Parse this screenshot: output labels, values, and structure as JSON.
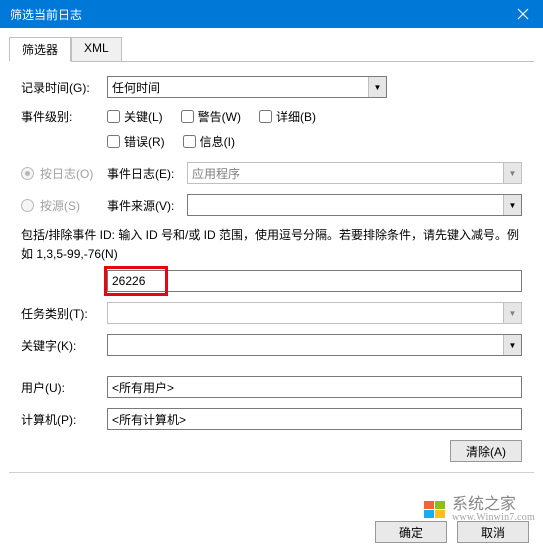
{
  "window": {
    "title": "筛选当前日志"
  },
  "tabs": {
    "filter": "筛选器",
    "xml": "XML"
  },
  "labels": {
    "logged": "记录时间(G):",
    "level": "事件级别:",
    "byLog": "按日志(O)",
    "bySource": "按源(S)",
    "eventLog": "事件日志(E):",
    "eventSource": "事件来源(V):",
    "task": "任务类别(T):",
    "keyword": "关键字(K):",
    "user": "用户(U):",
    "computer": "计算机(P):"
  },
  "dropdowns": {
    "loggedValue": "任何时间",
    "eventLogValue": "应用程序",
    "eventSourceValue": "",
    "taskValue": "",
    "keywordValue": ""
  },
  "checkboxes": {
    "critical": "关键(L)",
    "warning": "警告(W)",
    "verbose": "详细(B)",
    "error": "错误(R)",
    "info": "信息(I)"
  },
  "help": "包括/排除事件 ID: 输入 ID 号和/或 ID 范围，使用逗号分隔。若要排除条件，请先键入减号。例如 1,3,5-99,-76(N)",
  "inputs": {
    "idValue": "26226",
    "userPlaceholder": "<所有用户>",
    "computerPlaceholder": "<所有计算机>"
  },
  "buttons": {
    "clear": "清除(A)",
    "ok": "确定",
    "cancel": "取消"
  },
  "watermark": {
    "brand": "系统之家",
    "url": "www.Winwin7.com"
  }
}
